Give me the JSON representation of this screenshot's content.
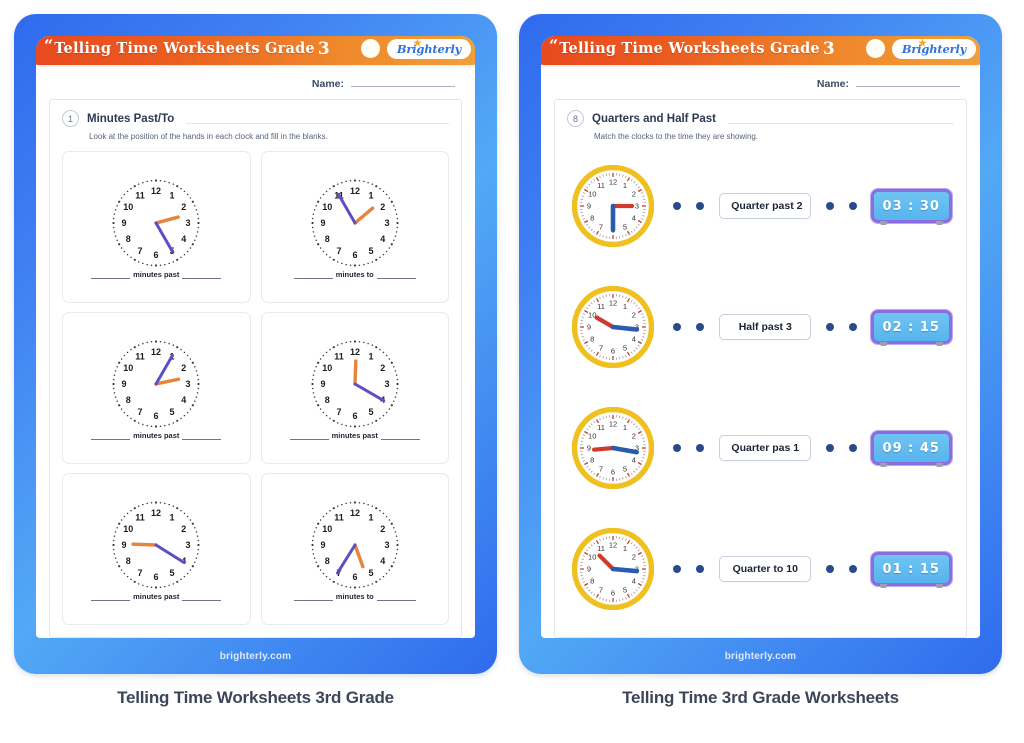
{
  "worksheets": [
    {
      "banner": {
        "quote": "“",
        "title": "Telling Time Worksheets Grade",
        "grade": "3",
        "logo": "Brighterly",
        "logo_icon": "starburst-icon",
        "dot_icon": "circle-icon"
      },
      "name_label": "Name:",
      "section": {
        "number": "1",
        "title": "Minutes Past/To",
        "instruction": "Look at the position of the hands in each clock and fill in the blanks."
      },
      "clocks": [
        {
          "label": "minutes past",
          "minute_hand_deg": 150,
          "hour_hand_deg": 75,
          "numerals": [
            "12",
            "1",
            "2",
            "3",
            "4",
            "5",
            "6",
            "7",
            "8",
            "9",
            "10",
            "11"
          ]
        },
        {
          "label": "minutes to",
          "minute_hand_deg": 330,
          "hour_hand_deg": 50,
          "numerals": [
            "12",
            "1",
            "2",
            "3",
            "4",
            "5",
            "6",
            "7",
            "8",
            "9",
            "10",
            "11"
          ]
        },
        {
          "label": "minutes past",
          "minute_hand_deg": 30,
          "hour_hand_deg": 78,
          "numerals": [
            "12",
            "1",
            "2",
            "3",
            "4",
            "5",
            "6",
            "7",
            "8",
            "9",
            "10",
            "11"
          ]
        },
        {
          "label": "minutes past",
          "minute_hand_deg": 120,
          "hour_hand_deg": 2,
          "numerals": [
            "12",
            "1",
            "2",
            "3",
            "4",
            "5",
            "6",
            "7",
            "8",
            "9",
            "10",
            "11"
          ]
        },
        {
          "label": "minutes past",
          "minute_hand_deg": 122,
          "hour_hand_deg": 272,
          "numerals": [
            "12",
            "1",
            "2",
            "3",
            "4",
            "5",
            "6",
            "7",
            "8",
            "9",
            "10",
            "11"
          ]
        },
        {
          "label": "minutes to",
          "minute_hand_deg": 212,
          "hour_hand_deg": 160,
          "numerals": [
            "12",
            "1",
            "2",
            "3",
            "4",
            "5",
            "6",
            "7",
            "8",
            "9",
            "10",
            "11"
          ]
        }
      ],
      "footer": "brighterly.com",
      "caption": "Telling Time Worksheets 3rd Grade"
    },
    {
      "banner": {
        "quote": "“",
        "title": "Telling Time Worksheets Grade",
        "grade": "3",
        "logo": "Brighterly",
        "logo_icon": "starburst-icon",
        "dot_icon": "circle-icon"
      },
      "name_label": "Name:",
      "section": {
        "number": "8",
        "title": "Quarters and Half Past",
        "instruction": "Match the clocks to the time they are showing."
      },
      "rows": [
        {
          "clock": {
            "minute_hand_deg": 180,
            "hour_hand_deg": 90
          },
          "phrase": "Quarter past 2",
          "digital": "03 : 30"
        },
        {
          "clock": {
            "minute_hand_deg": 96,
            "hour_hand_deg": 300
          },
          "phrase": "Half past 3",
          "digital": "02 : 15"
        },
        {
          "clock": {
            "minute_hand_deg": 100,
            "hour_hand_deg": 265
          },
          "phrase": "Quarter pas 1",
          "digital": "09 : 45"
        },
        {
          "clock": {
            "minute_hand_deg": 95,
            "hour_hand_deg": 315
          },
          "phrase": "Quarter to 10",
          "digital": "01 : 15"
        }
      ],
      "footer": "brighterly.com",
      "caption": "Telling Time 3rd Grade Worksheets"
    }
  ],
  "colors": {
    "banner_start": "#e8491f",
    "banner_end": "#f0a03a",
    "frame_blue": "#2f6bed",
    "minute_hand": "#5b4fc4",
    "hour_hand": "#e8833a",
    "analog_rim": "#f0c020",
    "analog_blue_hand": "#2a5bb0",
    "analog_red_hand": "#d03a2a",
    "digital_border": "#8a6ee0",
    "digital_screen": "#57b4ee",
    "caption_text": "#3c4659"
  }
}
